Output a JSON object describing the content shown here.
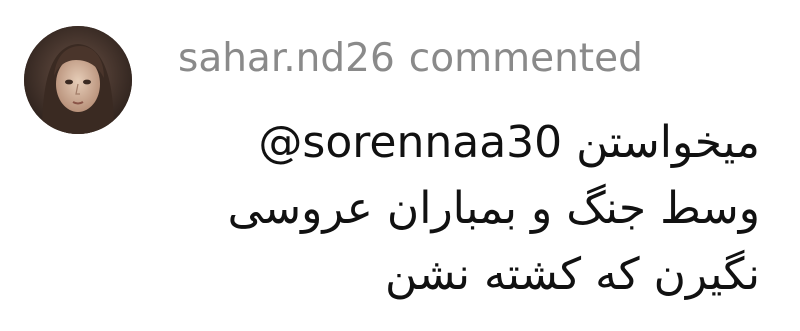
{
  "comment": {
    "avatar_icon": "user-avatar",
    "username": "sahar.nd26",
    "action": "commented",
    "line1_word": "میخواستن",
    "mention": "@sorennaa30",
    "line2": "وسط جنگ و بمباران عروسی",
    "line3": "نگیرن که کشته نشن"
  },
  "colors": {
    "background": "#ffffff",
    "header_text": "#8a8a8a",
    "body_text": "#111111"
  }
}
